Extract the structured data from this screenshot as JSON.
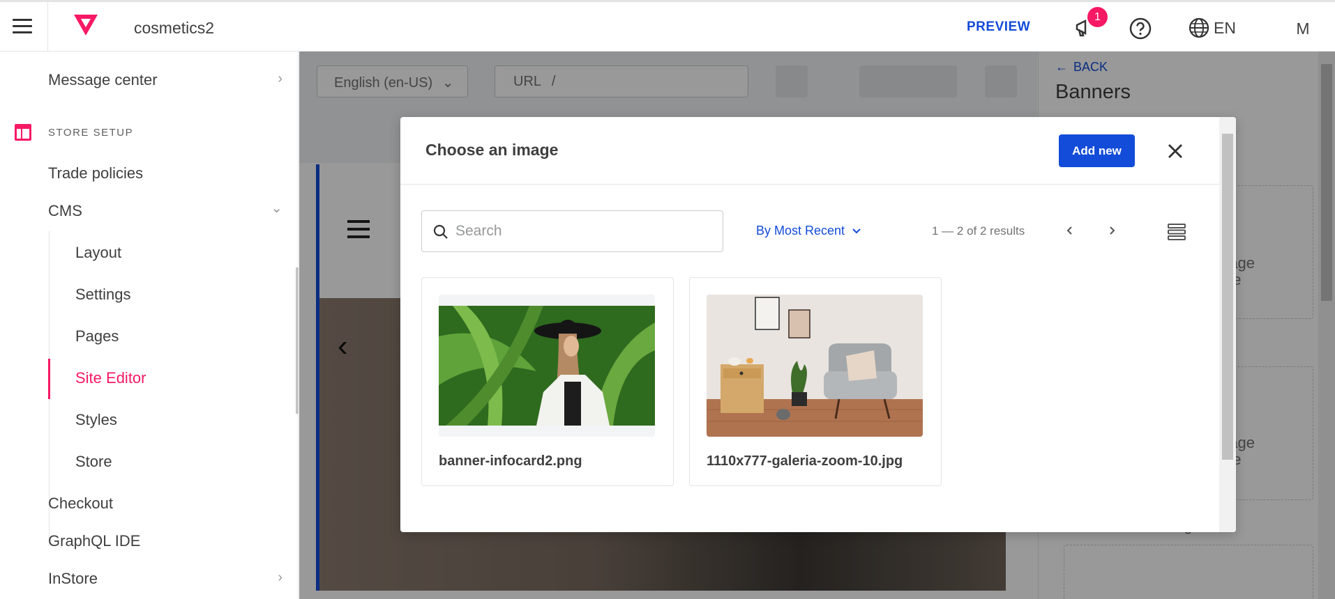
{
  "topbar": {
    "store_name": "cosmetics2",
    "preview_label": "PREVIEW",
    "notification_count": "1",
    "language": "EN",
    "avatar_initial": "M"
  },
  "sidebar": {
    "message_center": "Message center",
    "section_title": "STORE SETUP",
    "trade_policies": "Trade policies",
    "cms": "CMS",
    "cms_items": [
      "Layout",
      "Settings",
      "Pages",
      "Site Editor",
      "Styles",
      "Store"
    ],
    "checkout": "Checkout",
    "graphql": "GraphQL IDE",
    "instore": "InStore"
  },
  "editor": {
    "locale": "English (en-US)",
    "url_label": "URL",
    "url_value": "/"
  },
  "right_panel": {
    "back_label": "BACK",
    "title": "Banners",
    "box_text_1": "mage\nose",
    "box_text_2": "mage\nose",
    "field_label": "Banner tablet image"
  },
  "modal": {
    "title": "Choose an image",
    "add_new_label": "Add new",
    "search_placeholder": "Search",
    "sort_label": "By Most Recent",
    "results_text": "1 — 2 of 2 results",
    "images": [
      {
        "name": "banner-infocard2.png"
      },
      {
        "name": "1110x777-galeria-zoom-10.jpg"
      }
    ]
  },
  "colors": {
    "brand_pink": "#f71963",
    "brand_blue": "#134cd8"
  }
}
